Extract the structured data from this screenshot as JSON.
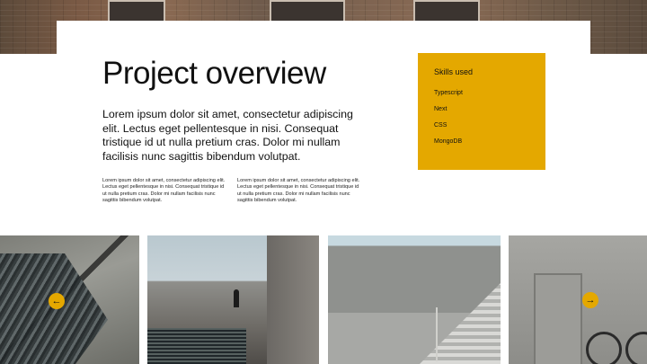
{
  "project": {
    "title": "Project overview",
    "lead": "Lorem ipsum dolor sit amet, consectetur adipiscing elit. Lectus eget pellentesque in nisi. Consequat tristique id ut nulla pretium cras. Dolor mi nullam facilisis nunc sagittis bibendum volutpat.",
    "paragraph_a": "Lorem ipsum dolor sit amet, consectetur adipiscing elit. Lectus eget pellentesque in nisi. Consequat tristique id ut nulla pretium cras. Dolor mi nullam facilisis nunc sagittis bibendum volutpat.",
    "paragraph_b": "Lorem ipsum dolor sit amet, consectetur adipiscing elit. Lectus eget pellentesque in nisi. Consequat tristique id ut nulla pretium cras. Dolor mi nullam facilisis nunc sagittis bibendum volutpat."
  },
  "skills": {
    "heading": "Skills used",
    "items": [
      "Typescript",
      "Next",
      "CSS",
      "MongoDB"
    ]
  },
  "gallery": {
    "prev_icon": "←",
    "next_icon": "→"
  },
  "colors": {
    "accent": "#e4a800"
  }
}
